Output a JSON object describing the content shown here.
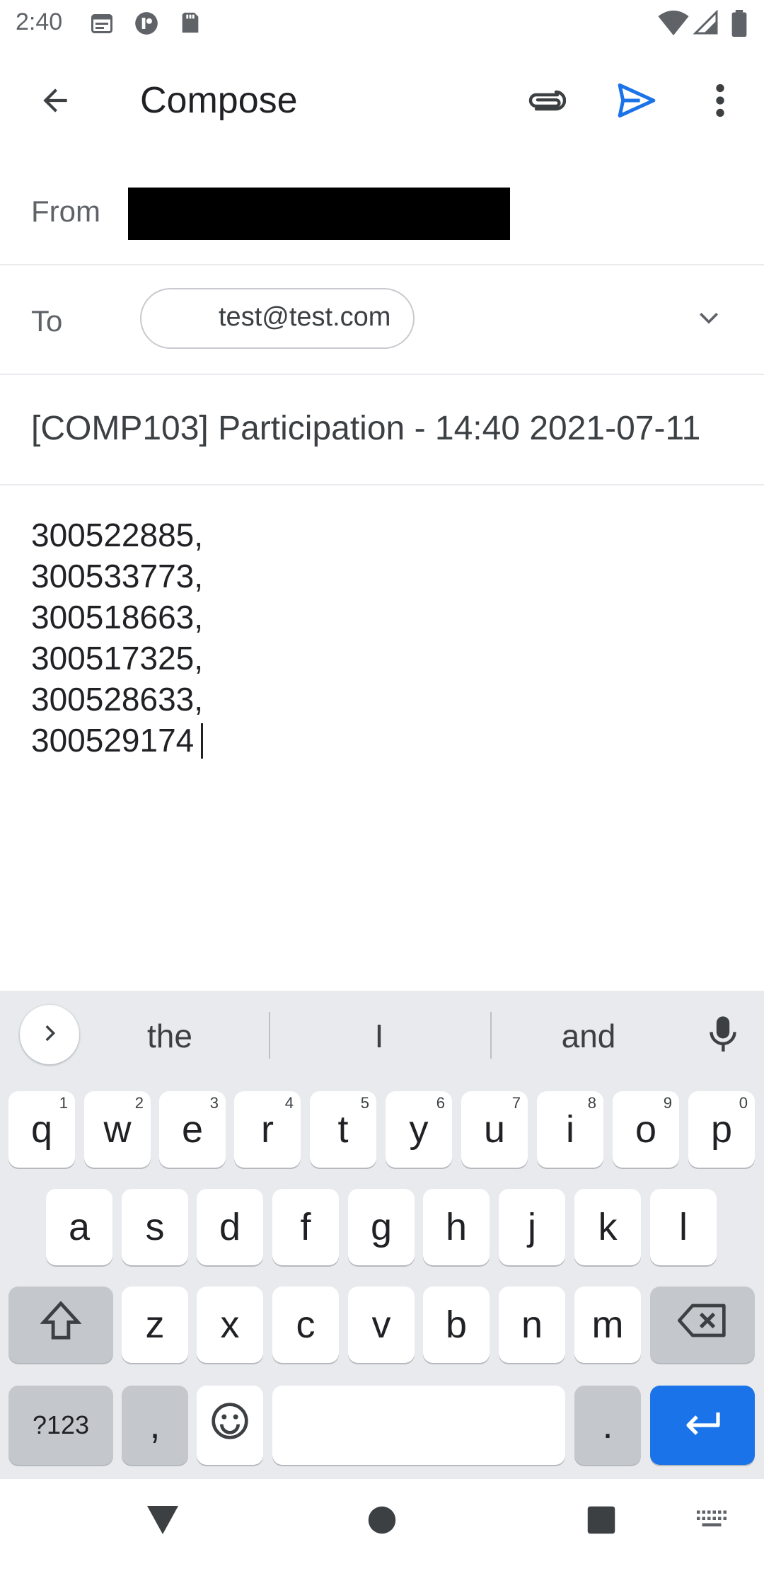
{
  "status_bar": {
    "time": "2:40"
  },
  "app_bar": {
    "title": "Compose",
    "back_icon": "arrow-back-icon",
    "attach_icon": "paperclip-icon",
    "send_icon": "send-icon",
    "more_icon": "more-vert-icon"
  },
  "from": {
    "label": "From"
  },
  "to": {
    "label": "To",
    "recipient": "test@test.com"
  },
  "subject": "[COMP103] Participation - 14:40 2021-07-11",
  "body": "300522885,\n300533773,\n300518663,\n300517325,\n300528633,\n300529174",
  "keyboard": {
    "suggestions": [
      "the",
      "I",
      "and"
    ],
    "row1": [
      {
        "k": "q",
        "h": "1"
      },
      {
        "k": "w",
        "h": "2"
      },
      {
        "k": "e",
        "h": "3"
      },
      {
        "k": "r",
        "h": "4"
      },
      {
        "k": "t",
        "h": "5"
      },
      {
        "k": "y",
        "h": "6"
      },
      {
        "k": "u",
        "h": "7"
      },
      {
        "k": "i",
        "h": "8"
      },
      {
        "k": "o",
        "h": "9"
      },
      {
        "k": "p",
        "h": "0"
      }
    ],
    "row2": [
      "a",
      "s",
      "d",
      "f",
      "g",
      "h",
      "j",
      "k",
      "l"
    ],
    "row3": [
      "z",
      "x",
      "c",
      "v",
      "b",
      "n",
      "m"
    ],
    "symbols_label": "?123",
    "comma": ",",
    "period": "."
  },
  "colors": {
    "accent": "#1a73e8",
    "keyboard_bg": "#e8eaed"
  }
}
